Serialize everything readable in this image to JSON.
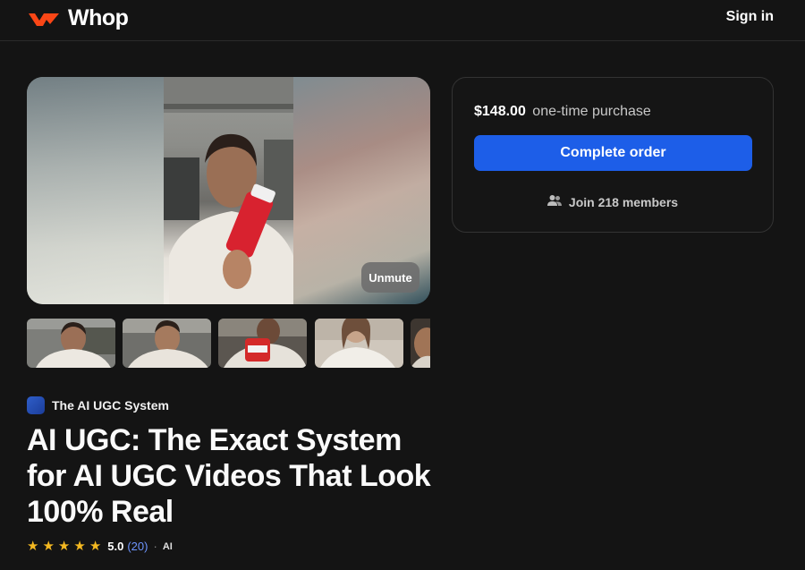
{
  "header": {
    "brand": "Whop",
    "sign_in": "Sign in"
  },
  "media": {
    "unmute_label": "Unmute",
    "thumbnail_count": 5
  },
  "product": {
    "creator_name": "The AI UGC System",
    "title": "AI UGC: The Exact System for AI UGC Videos That Look 100% Real",
    "rating": {
      "stars": 5,
      "score": "5.0",
      "count": "(20)",
      "separator": "·",
      "tag": "AI"
    }
  },
  "checkout": {
    "price": "$148.00",
    "price_note": "one-time purchase",
    "button_label": "Complete order",
    "members_label": "Join 218 members"
  },
  "colors": {
    "brand_orange": "#fa4616",
    "button_blue": "#1d5ee8",
    "star_yellow": "#f5b921",
    "link_blue": "#6e95ff"
  }
}
